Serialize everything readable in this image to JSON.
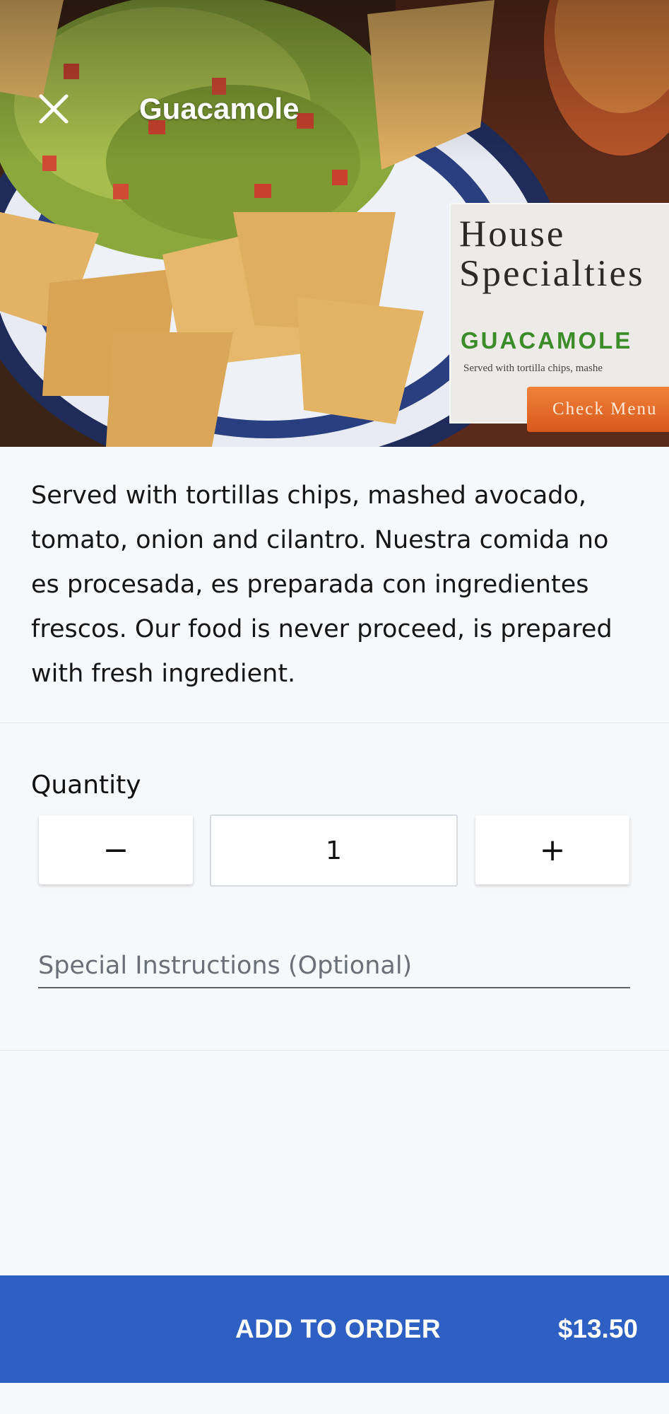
{
  "header": {
    "title": "Guacamole",
    "close_icon": "close-icon"
  },
  "hero": {
    "menu_card": {
      "heading": "House\nSpecialties",
      "item": "GUACAMOLE",
      "description": "Served with tortilla chips, mashe",
      "button": "Check Menu"
    }
  },
  "item": {
    "description": "Served with tortillas chips, mashed avocado, tomato, onion and cilantro. Nuestra comida no es procesada, es preparada con ingredientes frescos. Our food is never proceed, is prepared with fresh ingredient."
  },
  "quantity": {
    "label": "Quantity",
    "decrement": "−",
    "value": "1",
    "increment": "+"
  },
  "instructions": {
    "placeholder": "Special Instructions (Optional)",
    "value": ""
  },
  "footer": {
    "cta": "ADD TO ORDER",
    "price": "$13.50"
  },
  "colors": {
    "primary": "#2e60c4",
    "background": "#f7f8fa"
  }
}
